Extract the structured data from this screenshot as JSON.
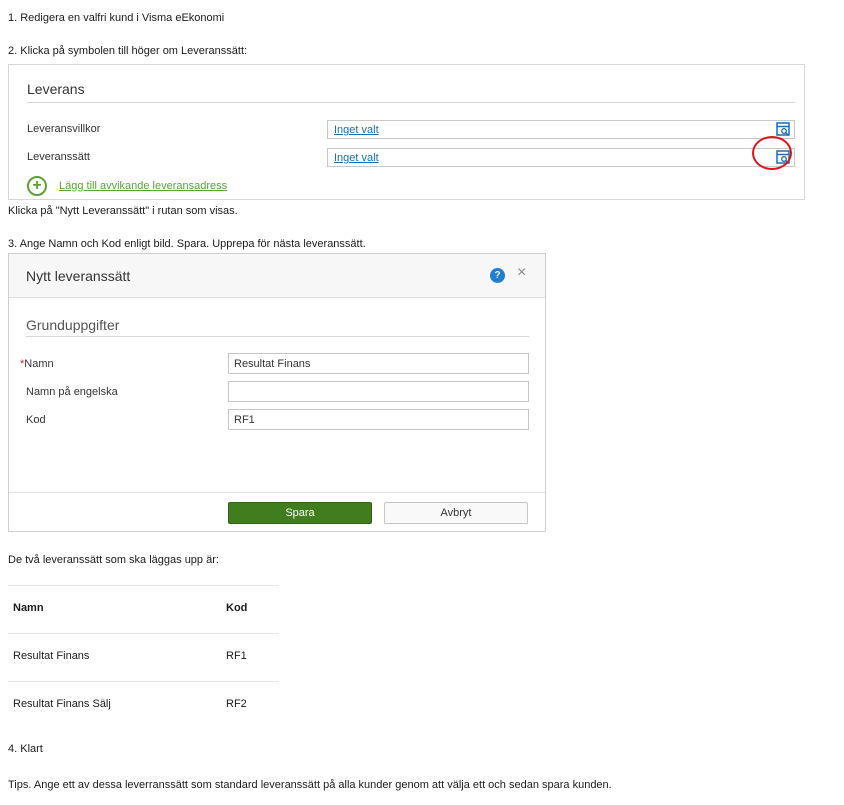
{
  "steps": {
    "step1": "1. Redigera en valfri kund i Visma eEkonomi",
    "step2": "2. Klicka på symbolen till höger om Leveranssätt:",
    "step2_after": "Klicka på \"Nytt Leveranssätt\" i rutan som visas.",
    "step3": "3. Ange Namn och Kod enligt bild. Spara. Upprepa för nästa leveranssätt.",
    "table_intro": "De två leveranssätt som ska läggas upp är:",
    "step4": "4. Klart",
    "tips": "Tips. Ange ett av dessa leverranssätt som standard leveranssätt på alla kunder genom att välja ett och sedan spara kunden."
  },
  "leverans_panel": {
    "title": "Leverans",
    "fields": [
      {
        "label": "Leveransvillkor",
        "value": "Inget valt"
      },
      {
        "label": "Leveranssätt",
        "value": "Inget valt"
      }
    ],
    "add_address_link": "Lägg till avvikande leveransadress",
    "lookup_icon": "lookup-icon",
    "highlight_color": "#e0141b"
  },
  "dialog": {
    "title": "Nytt leveranssätt",
    "help_glyph": "?",
    "close_glyph": "×",
    "section_title": "Grunduppgifter",
    "required_marker": "*",
    "fields": [
      {
        "label": "Namn",
        "value": "Resultat Finans",
        "required": true
      },
      {
        "label": "Namn på engelska",
        "value": "",
        "required": false
      },
      {
        "label": "Kod",
        "value": "RF1",
        "required": false
      }
    ],
    "save_label": "Spara",
    "cancel_label": "Avbryt",
    "save_color": "#3f7d1f"
  },
  "codes_table": {
    "headers": {
      "name": "Namn",
      "code": "Kod"
    },
    "rows": [
      {
        "name": "Resultat Finans",
        "code": "RF1"
      },
      {
        "name": "Resultat Finans Sälj",
        "code": "RF2"
      }
    ]
  }
}
